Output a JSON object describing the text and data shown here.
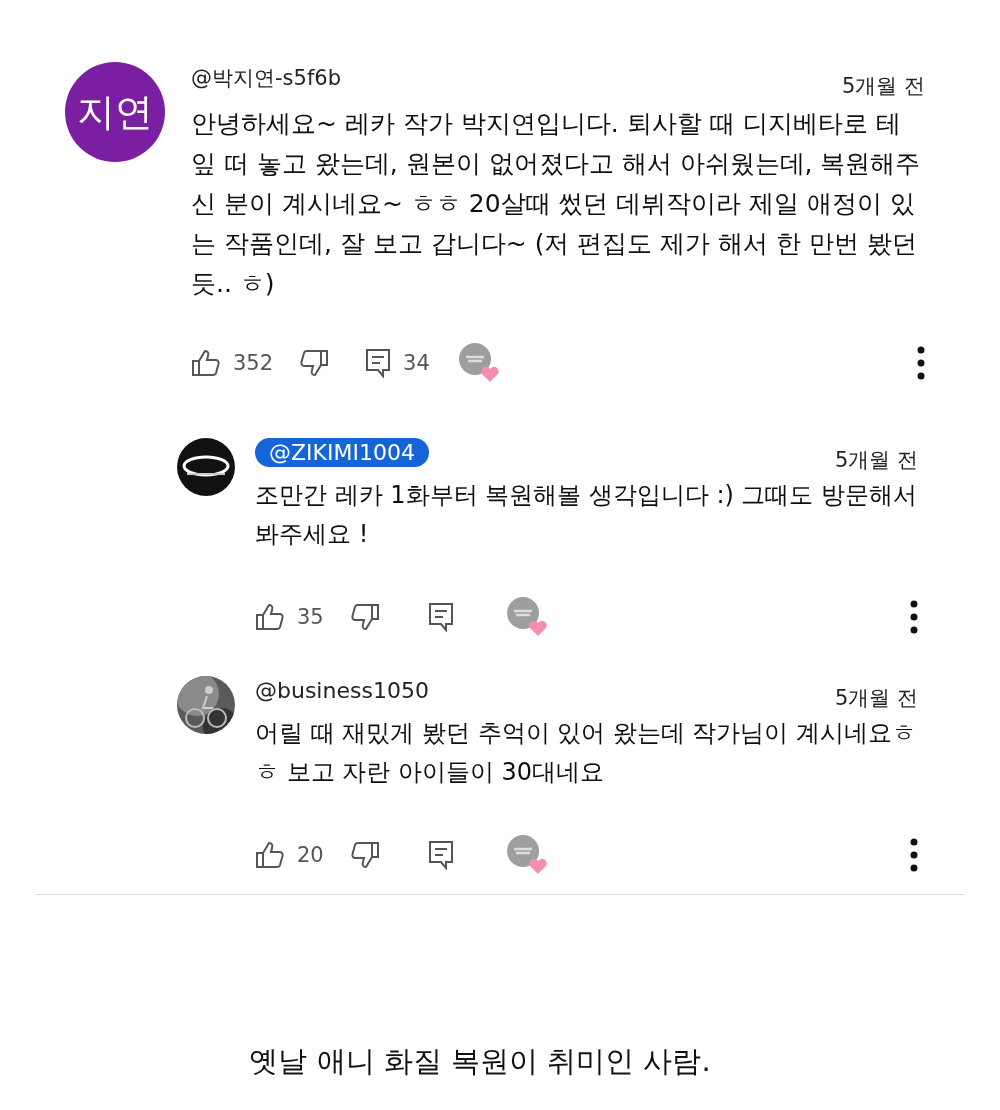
{
  "comments": [
    {
      "kind": "top",
      "avatar": {
        "kind": "initials",
        "text": "지연",
        "color": "#7b1fa2"
      },
      "author": "@박지연-s5f6b",
      "author_highlighted": false,
      "time": "5개월 전",
      "body": "안녕하세요~ 레카 작가 박지연입니다. 퇴사할 때 디지베타로 테잎 떠 놓고 왔는데, 원본이 없어졌다고 해서 아쉬웠는데, 복원해주신 분이 계시네요~ ㅎㅎ 20살때 썼던 데뷔작이라 제일 애정이 있는 작품인데, 잘 보고 갑니다~ (저 편집도 제가 해서 한 만번 봤던 듯.. ㅎ)",
      "likes": "352",
      "replies": "34",
      "hearted": true
    },
    {
      "kind": "reply",
      "avatar": {
        "kind": "logo"
      },
      "author": "@ZIKIMI1004",
      "author_highlighted": true,
      "time": "5개월 전",
      "body": "조만간 레카 1화부터 복원해볼 생각입니다 :) 그때도 방문해서 봐주세요 !",
      "likes": "35",
      "hearted": true
    },
    {
      "kind": "reply",
      "author": "@business1050",
      "author_highlighted": false,
      "time": "5개월 전",
      "body": "어릴 때 재밌게 봤던 추억이 있어 왔는데 작가님이 계시네요ㅎㅎ 보고 자란 아이들이 30대네요",
      "likes": "20",
      "hearted": true
    }
  ],
  "caption": "옛날 애니 화질 복원이 취미인 사람."
}
